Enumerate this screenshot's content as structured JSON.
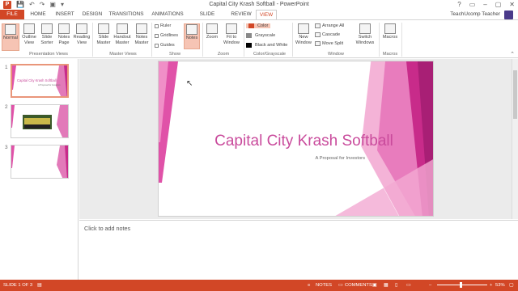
{
  "window": {
    "title": "Capital City Krash Softball - PowerPoint",
    "controls": [
      "?",
      "▭",
      "–",
      "▢",
      "✕"
    ]
  },
  "qat": {
    "logo": "P",
    "save": "💾",
    "undo": "↶",
    "redo": "↷",
    "present": "▣",
    "more": "▾"
  },
  "tabs": [
    "FILE",
    "HOME",
    "INSERT",
    "DESIGN",
    "TRANSITIONS",
    "ANIMATIONS",
    "SLIDE SHOW",
    "REVIEW",
    "VIEW"
  ],
  "active_tab": "VIEW",
  "user": "TeachUcomp Teacher",
  "ribbon": {
    "presentation_views": {
      "label": "Presentation Views",
      "buttons": [
        "Normal",
        "Outline View",
        "Slide Sorter",
        "Notes Page",
        "Reading View"
      ]
    },
    "master_views": {
      "label": "Master Views",
      "buttons": [
        "Slide Master",
        "Handout Master",
        "Notes Master"
      ]
    },
    "show": {
      "label": "Show",
      "items": [
        "Ruler",
        "Gridlines",
        "Guides"
      ],
      "notes": "Notes"
    },
    "zoom": {
      "label": "Zoom",
      "buttons": [
        "Zoom",
        "Fit to Window"
      ]
    },
    "color": {
      "label": "Color/Grayscale",
      "items": [
        "Color",
        "Grayscale",
        "Black and White"
      ]
    },
    "window": {
      "label": "Window",
      "new_window": "New Window",
      "items": [
        "Arrange All",
        "Cascade",
        "Move Split"
      ],
      "switch": "Switch Windows"
    },
    "macros": {
      "label": "Macros",
      "button": "Macros"
    }
  },
  "thumbnails": [
    {
      "num": "1",
      "title": "Capital City Krash Softball",
      "sub": "A Proposal for Investors"
    },
    {
      "num": "2"
    },
    {
      "num": "3"
    }
  ],
  "slide": {
    "title": "Capital City Krash Softball",
    "subtitle": "A Proposal for Investors"
  },
  "notes": {
    "placeholder": "Click to add notes"
  },
  "status": {
    "slide": "SLIDE 1 OF 3",
    "notes": "NOTES",
    "comments": "COMMENTS",
    "zoom": "53%"
  },
  "colors": {
    "accent": "#d24726",
    "pink": "#c94b9c"
  }
}
